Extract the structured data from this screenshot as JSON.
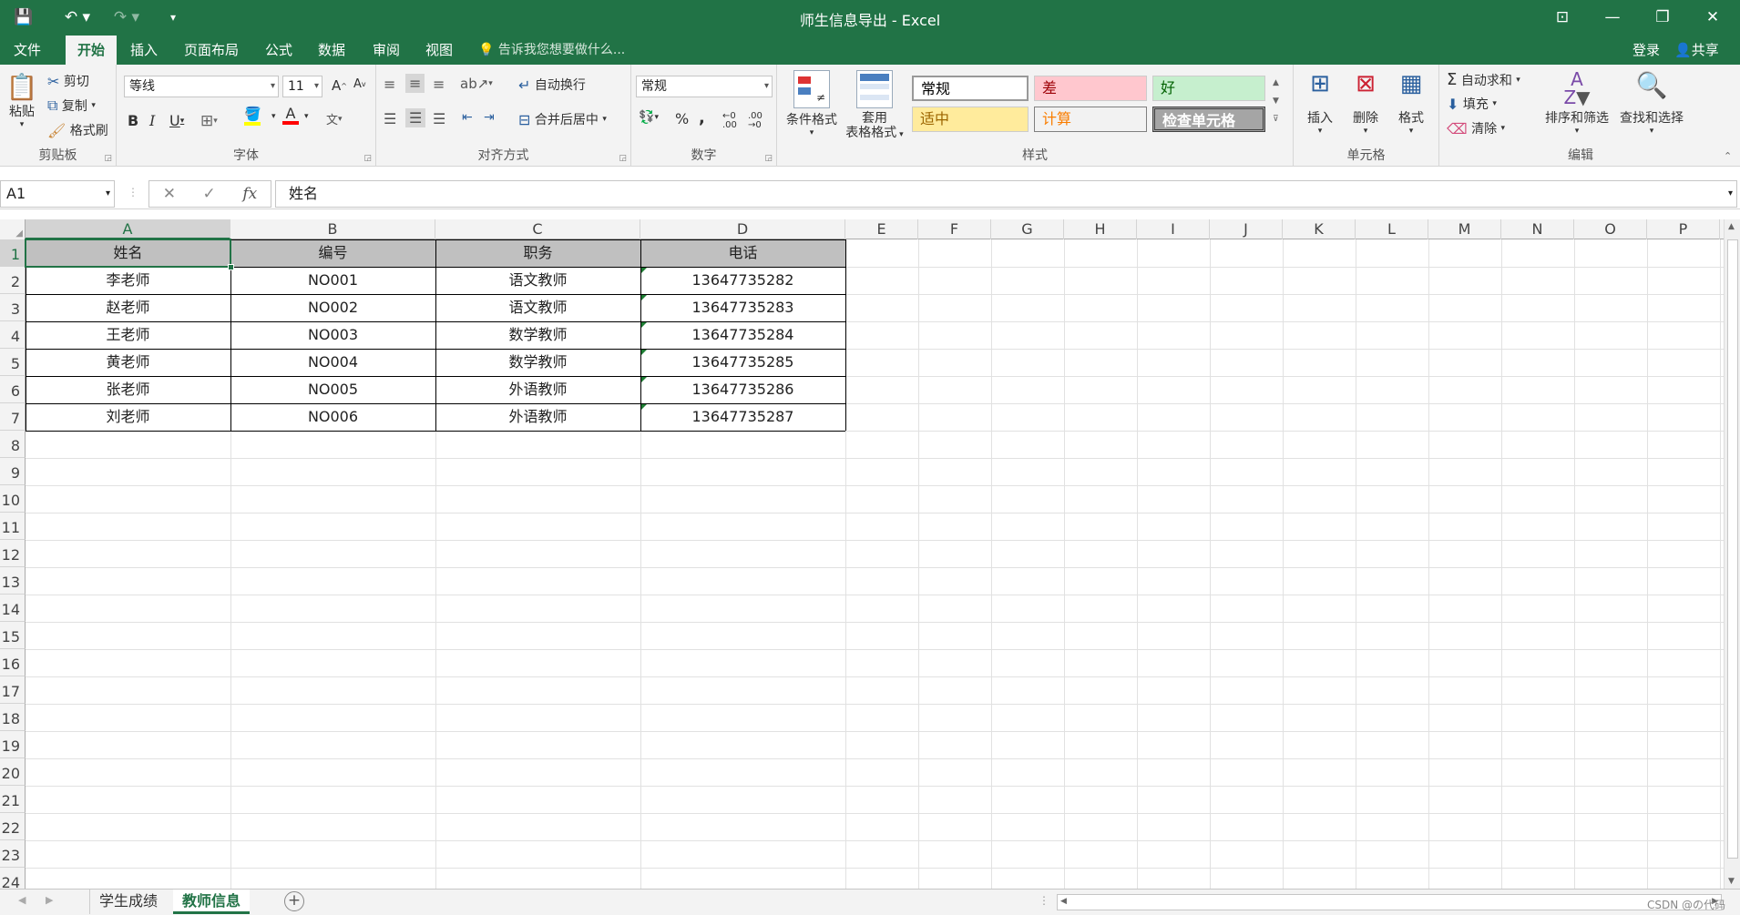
{
  "app": {
    "title": "师生信息导出 - Excel"
  },
  "menu": {
    "tabs": [
      "文件",
      "开始",
      "插入",
      "页面布局",
      "公式",
      "数据",
      "审阅",
      "视图"
    ],
    "active": "开始",
    "tell_me": "告诉我您想要做什么...",
    "login": "登录",
    "share": "共享"
  },
  "ribbon": {
    "clipboard": {
      "label": "剪贴板",
      "paste": "粘贴",
      "cut": "剪切",
      "copy": "复制",
      "format_painter": "格式刷"
    },
    "font": {
      "label": "字体",
      "font_name": "等线",
      "font_size": "11"
    },
    "alignment": {
      "label": "对齐方式",
      "wrap_text": "自动换行",
      "merge_center": "合并后居中"
    },
    "number": {
      "label": "数字",
      "format": "常规",
      "percent": "%",
      "comma": ","
    },
    "styles": {
      "label": "样式",
      "conditional": "条件格式",
      "table_format_1": "套用",
      "table_format_2": "表格格式",
      "cells": [
        {
          "text": "常规",
          "bg": "#ffffff",
          "fg": "#000000"
        },
        {
          "text": "差",
          "bg": "#ffc7ce",
          "fg": "#9c0006"
        },
        {
          "text": "好",
          "bg": "#c6efce",
          "fg": "#006100"
        },
        {
          "text": "适中",
          "bg": "#ffeb9c",
          "fg": "#9c6500"
        },
        {
          "text": "计算",
          "bg": "#f2f2f2",
          "fg": "#fa7d00"
        },
        {
          "text": "检查单元格",
          "bg": "#a5a5a5",
          "fg": "#ffffff"
        }
      ]
    },
    "cells": {
      "label": "单元格",
      "insert": "插入",
      "delete": "删除",
      "format": "格式"
    },
    "editing": {
      "label": "编辑",
      "autosum": "自动求和",
      "fill": "填充",
      "clear": "清除",
      "sort_filter": "排序和筛选",
      "find_select": "查找和选择"
    }
  },
  "formula_bar": {
    "name_box": "A1",
    "content": "姓名"
  },
  "columns": [
    "A",
    "B",
    "C",
    "D",
    "E",
    "F",
    "G",
    "H",
    "I",
    "J",
    "K",
    "L",
    "M",
    "N",
    "O",
    "P"
  ],
  "rows": [
    "1",
    "2",
    "3",
    "4",
    "5",
    "6",
    "7",
    "8",
    "9",
    "10",
    "11",
    "12",
    "13",
    "14",
    "15",
    "16",
    "17",
    "18",
    "19",
    "20",
    "21",
    "22",
    "23",
    "24"
  ],
  "table": {
    "headers": [
      "姓名",
      "编号",
      "职务",
      "电话"
    ],
    "data": [
      [
        "李老师",
        "NO001",
        "语文教师",
        "13647735282"
      ],
      [
        "赵老师",
        "NO002",
        "语文教师",
        "13647735283"
      ],
      [
        "王老师",
        "NO003",
        "数学教师",
        "13647735284"
      ],
      [
        "黄老师",
        "NO004",
        "数学教师",
        "13647735285"
      ],
      [
        "张老师",
        "NO005",
        "外语教师",
        "13647735286"
      ],
      [
        "刘老师",
        "NO006",
        "外语教师",
        "13647735287"
      ]
    ]
  },
  "sheets": [
    {
      "name": "学生成绩",
      "active": false
    },
    {
      "name": "教师信息",
      "active": true
    }
  ],
  "watermark": "CSDN @の代码",
  "colors": {
    "accent": "#217346",
    "header_fill": "#c0c0c0"
  }
}
